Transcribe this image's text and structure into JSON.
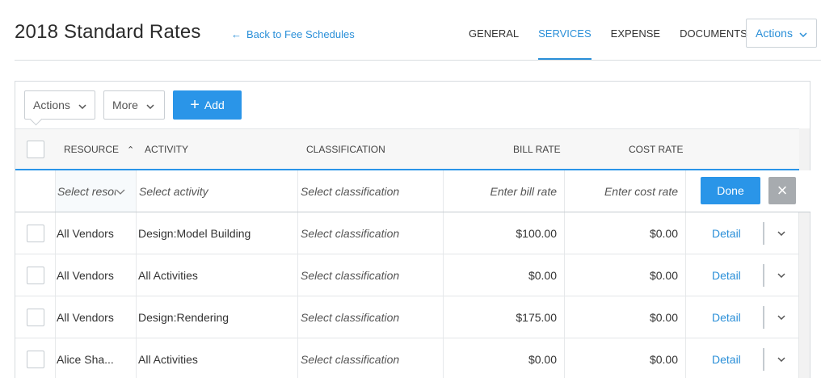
{
  "header": {
    "title": "2018 Standard Rates",
    "back_link": "Back to Fee Schedules",
    "tabs": [
      "GENERAL",
      "SERVICES",
      "EXPENSE",
      "DOCUMENTS"
    ],
    "active_tab": "SERVICES",
    "actions_label": "Actions"
  },
  "toolbar": {
    "actions_label": "Actions",
    "more_label": "More",
    "add_label": "Add"
  },
  "table": {
    "columns": [
      "RESOURCE",
      "ACTIVITY",
      "CLASSIFICATION",
      "BILL RATE",
      "COST RATE"
    ],
    "sort_column": "RESOURCE",
    "edit_row": {
      "resource_placeholder": "Select resource",
      "activity_placeholder": "Select activity",
      "classification_placeholder": "Select classification",
      "bill_rate_placeholder": "Enter bill rate",
      "cost_rate_placeholder": "Enter cost rate",
      "done_label": "Done"
    },
    "rows": [
      {
        "resource": "All Vendors",
        "activity": "Design:Model Building",
        "classification": "Select classification",
        "bill_rate": "$100.00",
        "cost_rate": "$0.00",
        "action": "Detail"
      },
      {
        "resource": "All Vendors",
        "activity": "All Activities",
        "classification": "Select classification",
        "bill_rate": "$0.00",
        "cost_rate": "$0.00",
        "action": "Detail"
      },
      {
        "resource": "All Vendors",
        "activity": "Design:Rendering",
        "classification": "Select classification",
        "bill_rate": "$175.00",
        "cost_rate": "$0.00",
        "action": "Detail"
      },
      {
        "resource": "Alice Sha...",
        "activity": "All Activities",
        "classification": "Select classification",
        "bill_rate": "$0.00",
        "cost_rate": "$0.00",
        "action": "Detail"
      }
    ]
  },
  "icons": {
    "back": "arrow-left-icon",
    "dropdown": "chevron-down-icon",
    "add": "plus-icon",
    "close": "close-icon",
    "sort": "sort-ascending-icon"
  },
  "colors": {
    "accent": "#2a95e8",
    "link": "#2a8fd8",
    "close_button": "#a7abaf"
  }
}
